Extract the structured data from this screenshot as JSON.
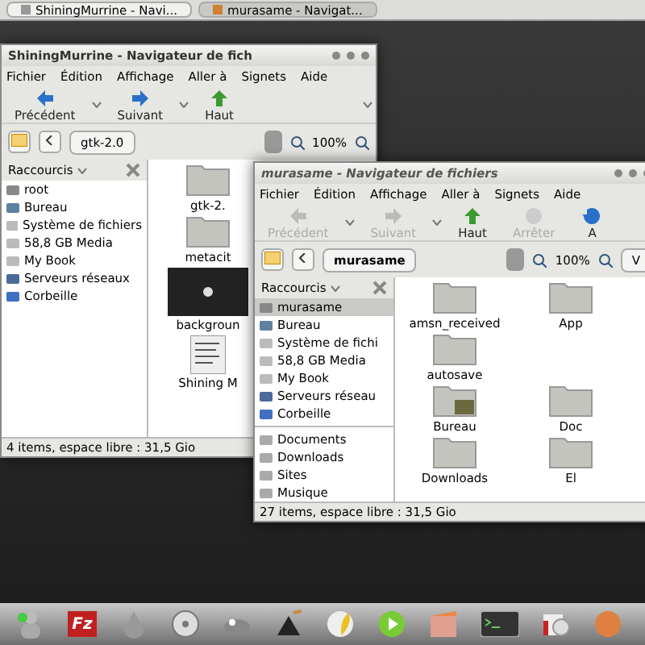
{
  "taskbar": {
    "tasks": [
      {
        "label": "ShiningMurrine - Navi...",
        "selected": false
      },
      {
        "label": "murasame - Navigat...",
        "selected": true
      }
    ]
  },
  "windows": [
    {
      "title": "ShiningMurrine - Navigateur de fich",
      "focused": false,
      "menu": [
        "Fichier",
        "Édition",
        "Affichage",
        "Aller à",
        "Signets",
        "Aide"
      ],
      "toolbar": [
        {
          "label": "Précédent",
          "kind": "back",
          "disabled": false,
          "caret": true
        },
        {
          "label": "Suivant",
          "kind": "forward",
          "disabled": false,
          "caret": true
        },
        {
          "label": "Haut",
          "kind": "up",
          "disabled": false,
          "caret": false
        }
      ],
      "toolbar_overflow": true,
      "location": {
        "path": "gtk-2.0",
        "zoom": "100%"
      },
      "sidebar": {
        "header": "Raccourcis",
        "places": [
          {
            "label": "root",
            "kind": "home",
            "selected": false
          },
          {
            "label": "Bureau",
            "kind": "desktop",
            "selected": false
          },
          {
            "label": "Système de fichiers",
            "kind": "drive",
            "selected": false
          },
          {
            "label": "58,8 GB Media",
            "kind": "drive",
            "selected": false
          },
          {
            "label": "My Book",
            "kind": "drive",
            "selected": false
          },
          {
            "label": "Serveurs réseaux",
            "kind": "network",
            "selected": false
          },
          {
            "label": "Corbeille",
            "kind": "trash",
            "selected": false
          }
        ]
      },
      "files": [
        [
          {
            "label": "gtk-2.",
            "kind": "folder"
          }
        ],
        [
          {
            "label": "metacit",
            "kind": "folder"
          }
        ],
        [
          {
            "label": "backgroun",
            "kind": "image"
          }
        ],
        [
          {
            "label": "Shining M",
            "kind": "document"
          }
        ]
      ],
      "status": "4 items, espace libre : 31,5 Gio"
    },
    {
      "title": "murasame - Navigateur de fichiers",
      "focused": true,
      "menu": [
        "Fichier",
        "Édition",
        "Affichage",
        "Aller à",
        "Signets",
        "Aide"
      ],
      "toolbar": [
        {
          "label": "Précédent",
          "kind": "back",
          "disabled": true,
          "caret": true
        },
        {
          "label": "Suivant",
          "kind": "forward",
          "disabled": true,
          "caret": true
        },
        {
          "label": "Haut",
          "kind": "up",
          "disabled": false,
          "caret": false
        },
        {
          "label": "Arrêter",
          "kind": "stop",
          "disabled": true,
          "caret": false
        },
        {
          "label": "A",
          "kind": "reload",
          "disabled": false,
          "caret": false
        }
      ],
      "toolbar_overflow": false,
      "location": {
        "path": "murasame",
        "zoom": "100%",
        "view": "V"
      },
      "sidebar": {
        "header": "Raccourcis",
        "places": [
          {
            "label": "murasame",
            "kind": "home",
            "selected": true
          },
          {
            "label": "Bureau",
            "kind": "desktop",
            "selected": false
          },
          {
            "label": "Système de fichi",
            "kind": "drive",
            "selected": false
          },
          {
            "label": "58,8 GB Media",
            "kind": "drive",
            "selected": false
          },
          {
            "label": "My Book",
            "kind": "drive",
            "selected": false
          },
          {
            "label": "Serveurs réseau",
            "kind": "network",
            "selected": false
          },
          {
            "label": "Corbeille",
            "kind": "trash",
            "selected": false
          }
        ],
        "bookmarks": [
          {
            "label": "Documents",
            "kind": "folder",
            "selected": false
          },
          {
            "label": "Downloads",
            "kind": "folder",
            "selected": false
          },
          {
            "label": "Sites",
            "kind": "folder",
            "selected": false
          },
          {
            "label": "Musique",
            "kind": "folder",
            "selected": false
          }
        ]
      },
      "files": [
        [
          {
            "label": "amsn_received",
            "kind": "folder"
          },
          {
            "label": "App",
            "kind": "folder"
          }
        ],
        [
          {
            "label": "autosave",
            "kind": "folder"
          }
        ],
        [
          {
            "label": "Bureau",
            "kind": "desktop-folder"
          },
          {
            "label": "Doc",
            "kind": "folder"
          }
        ],
        [
          {
            "label": "Downloads",
            "kind": "folder"
          },
          {
            "label": "El",
            "kind": "folder"
          }
        ]
      ],
      "status": "27 items, espace libre : 31,5 Gio"
    }
  ],
  "dock": [
    {
      "kind": "people"
    },
    {
      "kind": "ftp",
      "label": "Fz"
    },
    {
      "kind": "drop"
    },
    {
      "kind": "reel"
    },
    {
      "kind": "animal"
    },
    {
      "kind": "ink"
    },
    {
      "kind": "feather"
    },
    {
      "kind": "play"
    },
    {
      "kind": "calendar"
    },
    {
      "kind": "terminal"
    },
    {
      "kind": "disc"
    },
    {
      "kind": "orb"
    }
  ]
}
